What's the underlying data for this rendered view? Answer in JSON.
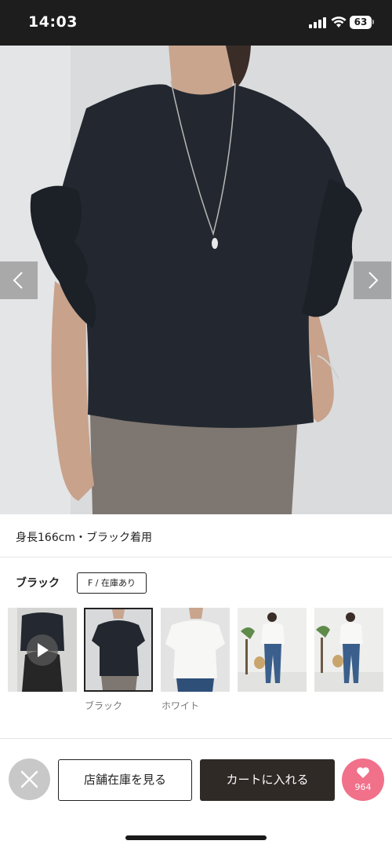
{
  "status_bar": {
    "time": "14:03",
    "battery": "63"
  },
  "product": {
    "model_caption": "身長166cm・ブラック着用",
    "selected_color": "ブラック",
    "size_stock": "F / 在庫あり"
  },
  "thumbnails": [
    {
      "label": "",
      "kind": "video"
    },
    {
      "label": "ブラック",
      "kind": "image",
      "selected": true
    },
    {
      "label": "ホワイト",
      "kind": "image"
    },
    {
      "label": "",
      "kind": "image"
    },
    {
      "label": "",
      "kind": "image"
    }
  ],
  "actions": {
    "store_stock_label": "店舗在庫を見る",
    "add_to_cart_label": "カートに入れる",
    "favorite_count": "964"
  },
  "colors": {
    "cart_button": "#2f2a26",
    "favorite_button": "#f1708a",
    "close_button": "#c8c8c8"
  },
  "icons": [
    "signal-icon",
    "wifi-icon",
    "battery-icon",
    "chevron-left-icon",
    "chevron-right-icon",
    "play-icon",
    "close-icon",
    "heart-icon"
  ]
}
